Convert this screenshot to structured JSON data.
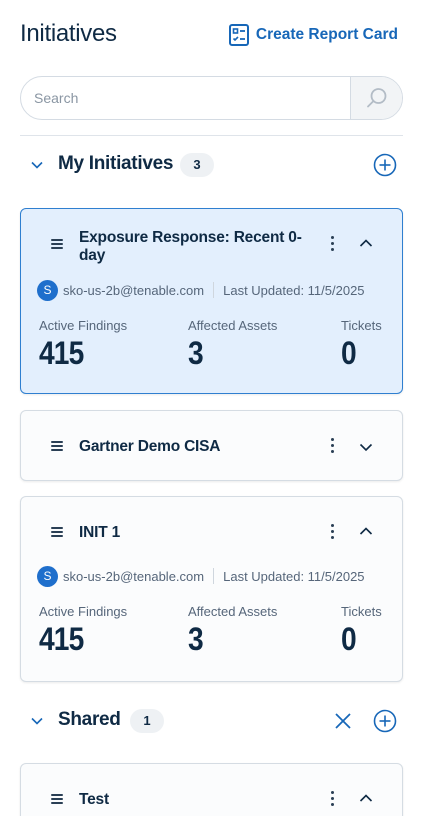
{
  "header": {
    "title": "Initiatives",
    "create_label": "Create Report Card"
  },
  "search": {
    "placeholder": "Search",
    "value": ""
  },
  "my_initiatives": {
    "title": "My Initiatives",
    "count": "3",
    "cards": [
      {
        "name": "Exposure Response: Recent 0-day",
        "expanded": true,
        "selected": true,
        "owner_initial": "S",
        "owner": "sko-us-2b@tenable.com",
        "last_updated": "Last Updated: 11/5/2025",
        "stats": {
          "active_findings_label": "Active Findings",
          "active_findings": "415",
          "affected_assets_label": "Affected Assets",
          "affected_assets": "3",
          "tickets_label": "Tickets",
          "tickets": "0"
        }
      },
      {
        "name": "Gartner Demo CISA",
        "expanded": false,
        "selected": false
      },
      {
        "name": "INIT 1",
        "expanded": true,
        "selected": false,
        "owner_initial": "S",
        "owner": "sko-us-2b@tenable.com",
        "last_updated": "Last Updated: 11/5/2025",
        "stats": {
          "active_findings_label": "Active Findings",
          "active_findings": "415",
          "affected_assets_label": "Affected Assets",
          "affected_assets": "3",
          "tickets_label": "Tickets",
          "tickets": "0"
        }
      }
    ]
  },
  "shared": {
    "title": "Shared",
    "count": "1",
    "cards": [
      {
        "name": "Test",
        "expanded": true,
        "selected": false
      }
    ]
  },
  "colors": {
    "accent": "#1767b8",
    "selected_bg": "#e3effd",
    "selected_border": "#2f7fd0",
    "avatar": "#1f6fcc"
  },
  "icons": {
    "create": "report-card-icon",
    "search": "search-icon",
    "section_collapse": "chevron-down-icon",
    "add": "add-circle-icon",
    "close": "close-icon",
    "drag": "drag-handle-icon",
    "more": "more-vertical-icon",
    "expand": "chevron-up-icon",
    "collapse": "chevron-down-icon"
  }
}
